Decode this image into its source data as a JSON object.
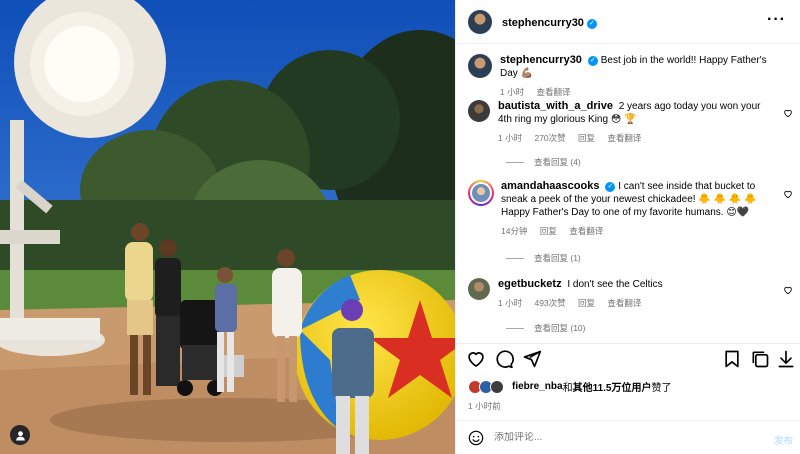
{
  "post": {
    "author": "stephencurry30",
    "tagged_icon": "person-tag-icon"
  },
  "caption": {
    "username": "stephencurry30",
    "text": "Best job in the world!! Happy Father's Day 💪🏽",
    "time": "1 小时",
    "translate": "查看翻译"
  },
  "comments": [
    {
      "username": "bautista_with_a_drive",
      "text": "2 years ago today you won your 4th ring my glorious King 😳 🏆",
      "time": "1 小时",
      "likes": "270次赞",
      "reply": "回复",
      "translate": "查看翻译",
      "view_replies": "查看回复 (4)"
    },
    {
      "username": "amandahaascooks",
      "text": "I can't see inside that bucket to sneak a peek of the your newest chickadee! 🐥 🐥 🐥 🐥 Happy Father's Day to one of my favorite humans. 😊🖤",
      "time": "14分钟",
      "reply": "回复",
      "translate": "查看翻译",
      "view_replies": "查看回复 (1)"
    },
    {
      "username": "egetbucketz",
      "text": "I don't see the Celtics",
      "time": "1 小时",
      "likes": "493次赞",
      "reply": "回复",
      "translate": "查看翻译",
      "view_replies": "查看回复 (10)"
    }
  ],
  "likes": {
    "user": "fiebre_nba",
    "conj": "和",
    "others": "其他11.5万位用户",
    "suffix": "赞了"
  },
  "time_ago": "1 小时前",
  "composer": {
    "placeholder": "添加评论...",
    "post_label": "发布"
  },
  "colors": {
    "link_blue": "#0095f6",
    "meta_gray": "#737373"
  }
}
